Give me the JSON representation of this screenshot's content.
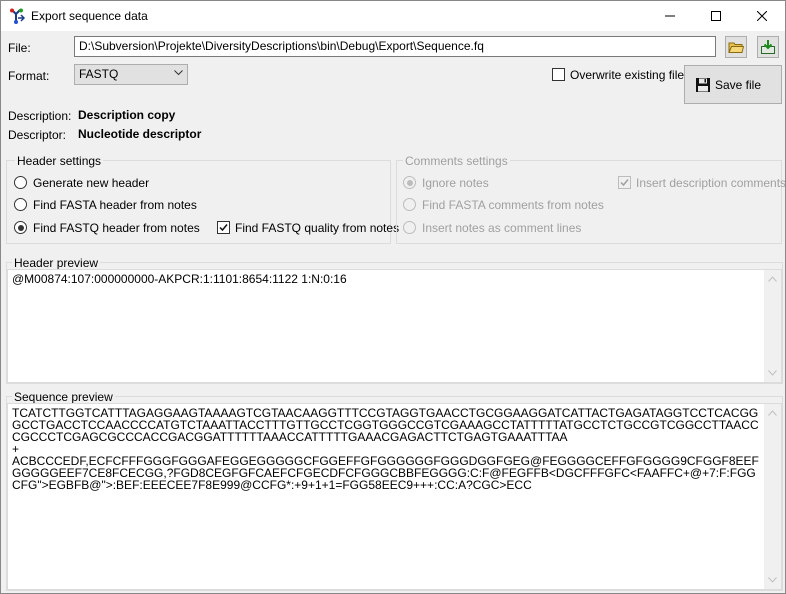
{
  "window": {
    "title": "Export sequence data"
  },
  "file": {
    "label": "File:",
    "path": "D:\\Subversion\\Projekte\\DiversityDescriptions\\bin\\Debug\\Export\\Sequence.fq"
  },
  "format": {
    "label": "Format:",
    "selected": "FASTQ"
  },
  "overwrite": {
    "label": "Overwrite existing file",
    "checked": false
  },
  "save_button": {
    "label": "Save file"
  },
  "description": {
    "label": "Description:",
    "value": "Description copy"
  },
  "descriptor": {
    "label": "Descriptor:",
    "value": "Nucleotide descriptor"
  },
  "header_settings": {
    "title": "Header settings",
    "options": [
      {
        "label": "Generate new header",
        "checked": false
      },
      {
        "label": "Find FASTA header from notes",
        "checked": false
      },
      {
        "label": "Find FASTQ header from notes",
        "checked": true
      }
    ],
    "quality_checkbox": {
      "label": "Find FASTQ quality from notes",
      "checked": true
    }
  },
  "comments_settings": {
    "title": "Comments settings",
    "options": [
      {
        "label": "Ignore notes",
        "checked": true
      },
      {
        "label": "Find FASTA comments from notes",
        "checked": false
      },
      {
        "label": "Insert notes as comment lines",
        "checked": false
      }
    ],
    "insert_description": {
      "label": "Insert description comments",
      "checked": true
    }
  },
  "header_preview": {
    "title": "Header preview",
    "text": "@M00874:107:000000000-AKPCR:1:1101:8654:1122 1:N:0:16"
  },
  "sequence_preview": {
    "title": "Sequence preview",
    "lines": [
      "TCATCTTGGTCATTTAGAGGAAGTAAAAGTCGTAACAAGGTTTCCGTAGGTGAACCTGCGGAAGGATCATTACTGAGATAGGTCCTCACGGGCCTGACCTCCAACCCCATGTCTAAATTACCTTTGTTGCCTCGGTGGGCCGTCGAAAGCCTATTTTTATGCCTCTGCCGTCGGCCTTAACCCGCCCTCGAGCGCCCACCGACGGATTTTTTAAACCATTTTTGAAACGAGACTTCTGAGTGAAATTTAA",
      "+",
      "ACBCCCEDF,ECFCFFFGGGFGGGAFEGGEGGGGGCFGGEFFGFGGGGGGFGGGDGGFGEG@FEGGGGCEFFGFGGGG9CFGGF8EEFGGGGGEEF7CE8FCECGG,?FGD8CEGFGFCAEFCFGECDFCFGGGCBBFEGGGG:C:F@FEGFFB<DGCFFFGFC<FAAFFC+@+7:F:FGGCFG\">EGBFB@\">:BEF:EEECEE7F8E999@CCFG*:+9+1+1=FGG58EEC9+++:CC:A?CGC>ECC"
    ]
  }
}
